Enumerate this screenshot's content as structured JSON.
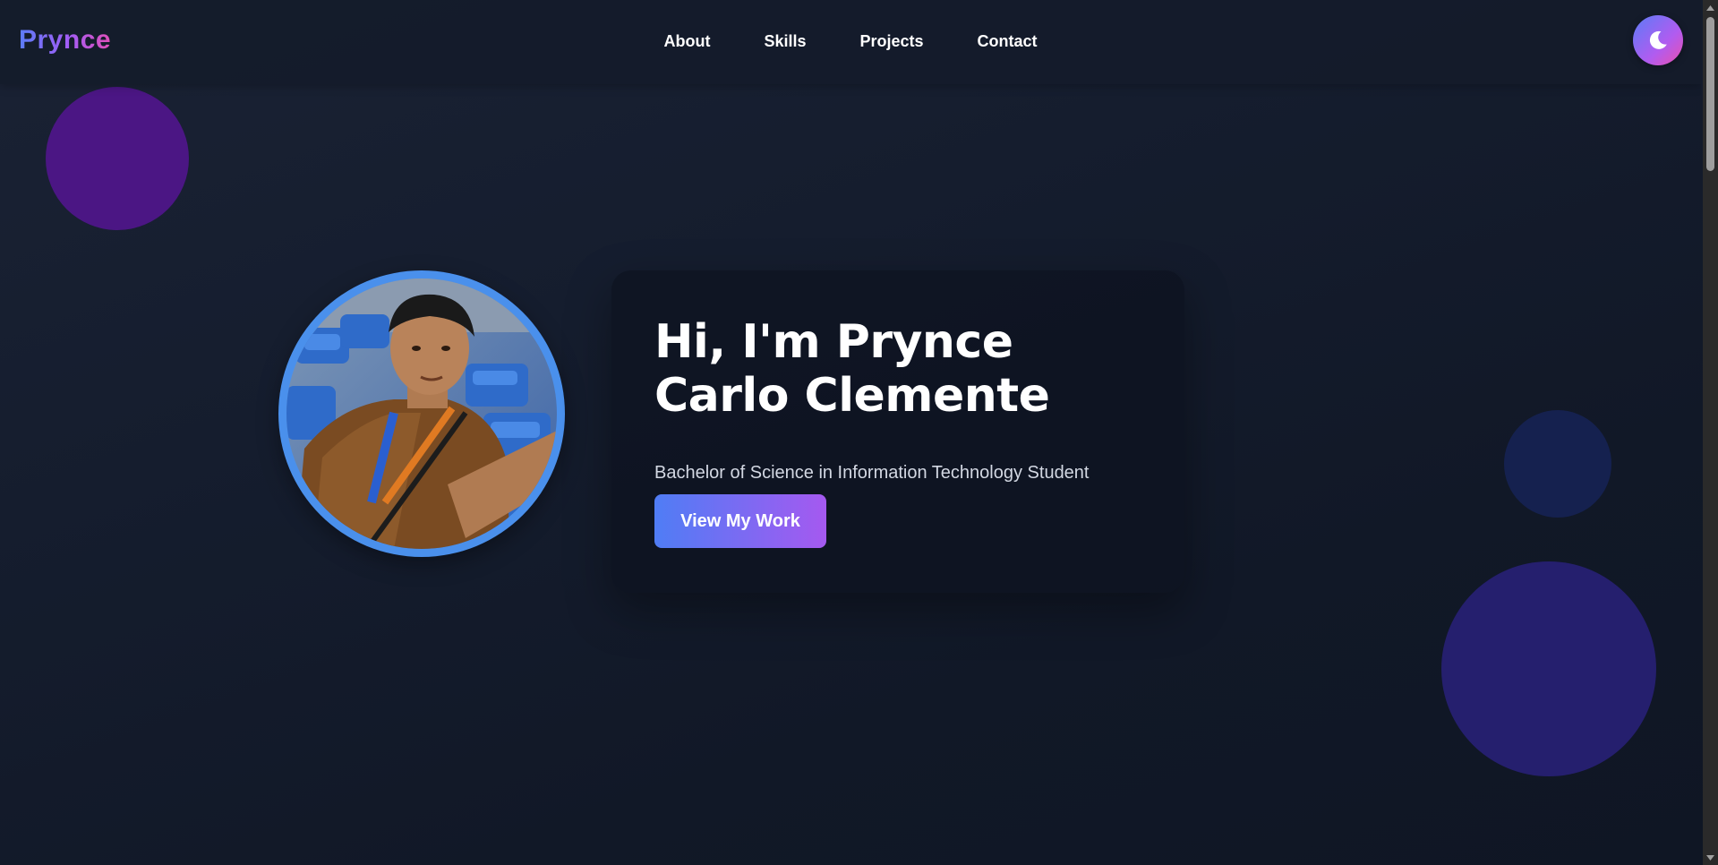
{
  "brand": {
    "logo_text": "Prynce",
    "gradient_colors": [
      "#5b7cf7",
      "#a45cf5",
      "#e04fb8"
    ]
  },
  "nav": {
    "links": [
      {
        "label": "About"
      },
      {
        "label": "Skills"
      },
      {
        "label": "Projects"
      },
      {
        "label": "Contact"
      }
    ],
    "theme_toggle_icon": "moon-icon"
  },
  "hero": {
    "title": "Hi, I'm Prynce Carlo Clemente",
    "subtitle": "Bachelor of Science in Information Technology Student",
    "cta_label": "View My Work",
    "avatar_ring_color": "#4a90ec"
  },
  "theme": {
    "background": "#111827",
    "accent_start": "#4f7df5",
    "accent_end": "#a559f0"
  }
}
